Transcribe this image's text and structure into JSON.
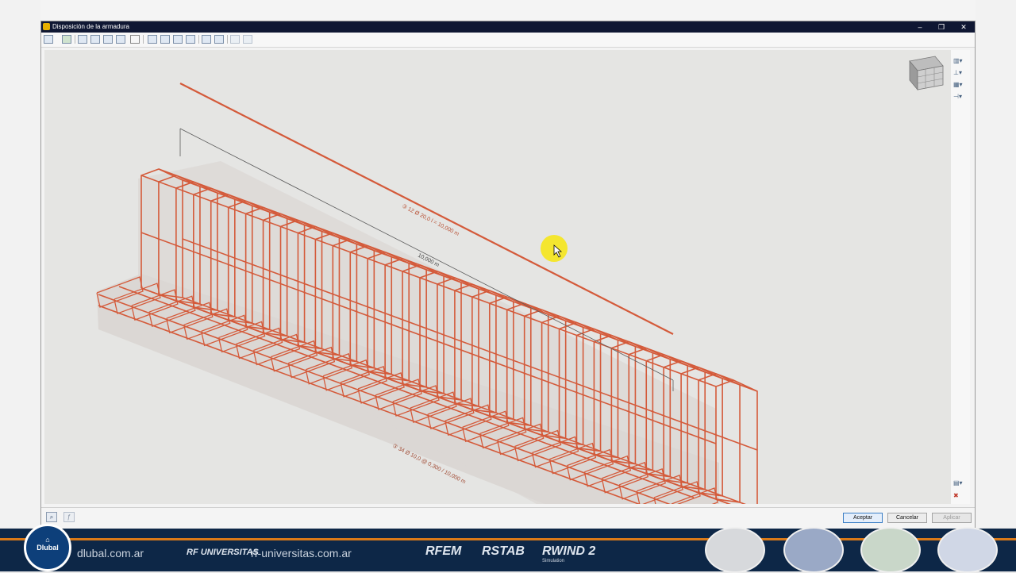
{
  "window": {
    "title": "Disposición de la armadura",
    "minimize": "–",
    "restore": "❐",
    "close": "✕"
  },
  "toolbar": {
    "icons": [
      "print-icon",
      "export-icon",
      "view-icon",
      "section-icon",
      "frame-icon",
      "grid-icon",
      "axis-icon",
      "layer-icon",
      "filter-icon",
      "table-icon",
      "link-icon",
      "dimension-icon",
      "measure-icon",
      "arrow-left-icon",
      "arrow-right-icon"
    ]
  },
  "viewport": {
    "top_bar_label": "③ 12 Ø 20,0 l = 10,000 m",
    "dimension_label": "10,000 m",
    "stirrup_label": "③ 34 Ø 10,0 @ 0,300 / 10,000 m",
    "colors": {
      "rebar": "#d45a3a",
      "dimension": "#555555",
      "cursor": "#f5e51b"
    }
  },
  "sidebar": {
    "icons": [
      "view-cube-icon",
      "display-options-icon",
      "coordinate-icon",
      "render-icon",
      "settings-icon",
      "print-graphic-icon",
      "reset-icon"
    ]
  },
  "bottom": {
    "aceptar": "Aceptar",
    "cancelar": "Cancelar",
    "aplicar": "Aplicar"
  },
  "banner": {
    "logo": "Dlubal",
    "site1": "dlubal.com.ar",
    "rf_universitas": "RF UNIVERSITAS",
    "site2": "rf-universitas.com.ar",
    "products": [
      "RFEM",
      "RSTAB",
      "RWIND 2"
    ],
    "rwind_sub": "Simulation"
  }
}
